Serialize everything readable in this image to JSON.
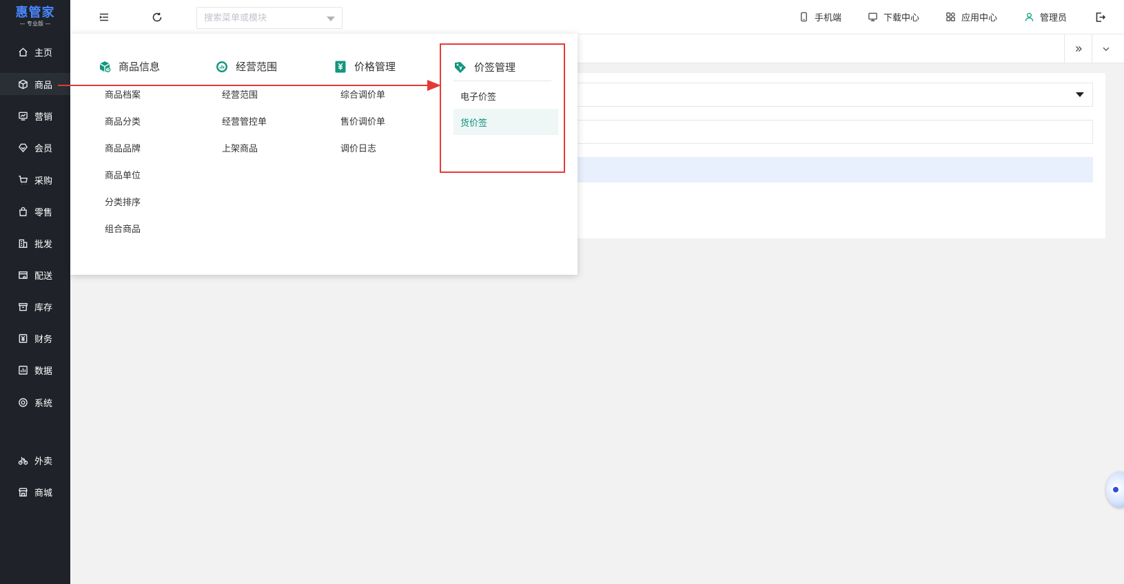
{
  "brand": {
    "name": "惠管家",
    "edition": "— 专业版 —",
    "color": "#4a86ff"
  },
  "sidebar": {
    "items": [
      {
        "label": "主页",
        "icon": "home-icon"
      },
      {
        "label": "商品",
        "icon": "box-icon",
        "active": true
      },
      {
        "label": "营销",
        "icon": "chart-icon"
      },
      {
        "label": "会员",
        "icon": "diamond-icon"
      },
      {
        "label": "采购",
        "icon": "cart-icon"
      },
      {
        "label": "零售",
        "icon": "bag-icon"
      },
      {
        "label": "批发",
        "icon": "building-icon"
      },
      {
        "label": "配送",
        "icon": "truck-icon"
      },
      {
        "label": "库存",
        "icon": "archive-icon"
      },
      {
        "label": "财务",
        "icon": "yen-icon"
      },
      {
        "label": "数据",
        "icon": "bar-chart-icon"
      },
      {
        "label": "系统",
        "icon": "settings-icon"
      },
      {
        "label": "外卖",
        "icon": "bike-icon"
      },
      {
        "label": "商城",
        "icon": "store-icon"
      }
    ]
  },
  "topbar": {
    "search_placeholder": "搜索菜单或模块",
    "links": [
      {
        "label": "手机端",
        "icon": "phone-icon"
      },
      {
        "label": "下载中心",
        "icon": "download-icon"
      },
      {
        "label": "应用中心",
        "icon": "apps-icon"
      },
      {
        "label": "管理员",
        "icon": "user-icon"
      }
    ]
  },
  "mega_menu": {
    "accent": "#0f8f7c",
    "columns": [
      {
        "title": "商品信息",
        "icon": "cube-icon",
        "items": [
          "商品档案",
          "商品分类",
          "商品品牌",
          "商品单位",
          "分类排序",
          "组合商品"
        ]
      },
      {
        "title": "经营范围",
        "icon": "scope-icon",
        "items": [
          "经营范围",
          "经营管控单",
          "上架商品"
        ]
      },
      {
        "title": "价格管理",
        "icon": "price-icon",
        "items": [
          "综合调价单",
          "售价调价单",
          "调价日志"
        ]
      },
      {
        "title": "价签管理",
        "icon": "tag-icon",
        "items": [
          "电子价签",
          "货价签"
        ],
        "active_item": "货价签"
      }
    ]
  },
  "annotation": {
    "highlight_color": "#e53935"
  }
}
